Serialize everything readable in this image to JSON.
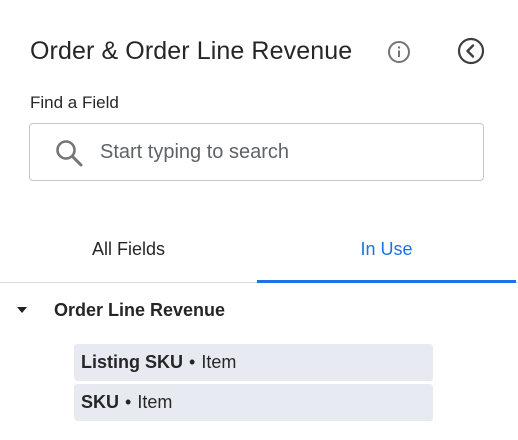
{
  "panel": {
    "title": "Order & Order Line Revenue",
    "info_icon": "info-icon",
    "collapse_icon": "chevron-left-circle-icon"
  },
  "search": {
    "label": "Find a Field",
    "placeholder": "Start typing to search",
    "value": ""
  },
  "tabs": [
    {
      "label": "All Fields",
      "active": false
    },
    {
      "label": "In Use",
      "active": true
    }
  ],
  "group": {
    "label": "Order Line Revenue",
    "expanded": true,
    "items": [
      {
        "name": "Listing SKU",
        "separator": "•",
        "type": "Item"
      },
      {
        "name": "SKU",
        "separator": "•",
        "type": "Item"
      }
    ]
  },
  "colors": {
    "accent": "#1a73e8",
    "item_bg": "#e8eaf2",
    "text": "#262626",
    "border": "#dadce0"
  }
}
